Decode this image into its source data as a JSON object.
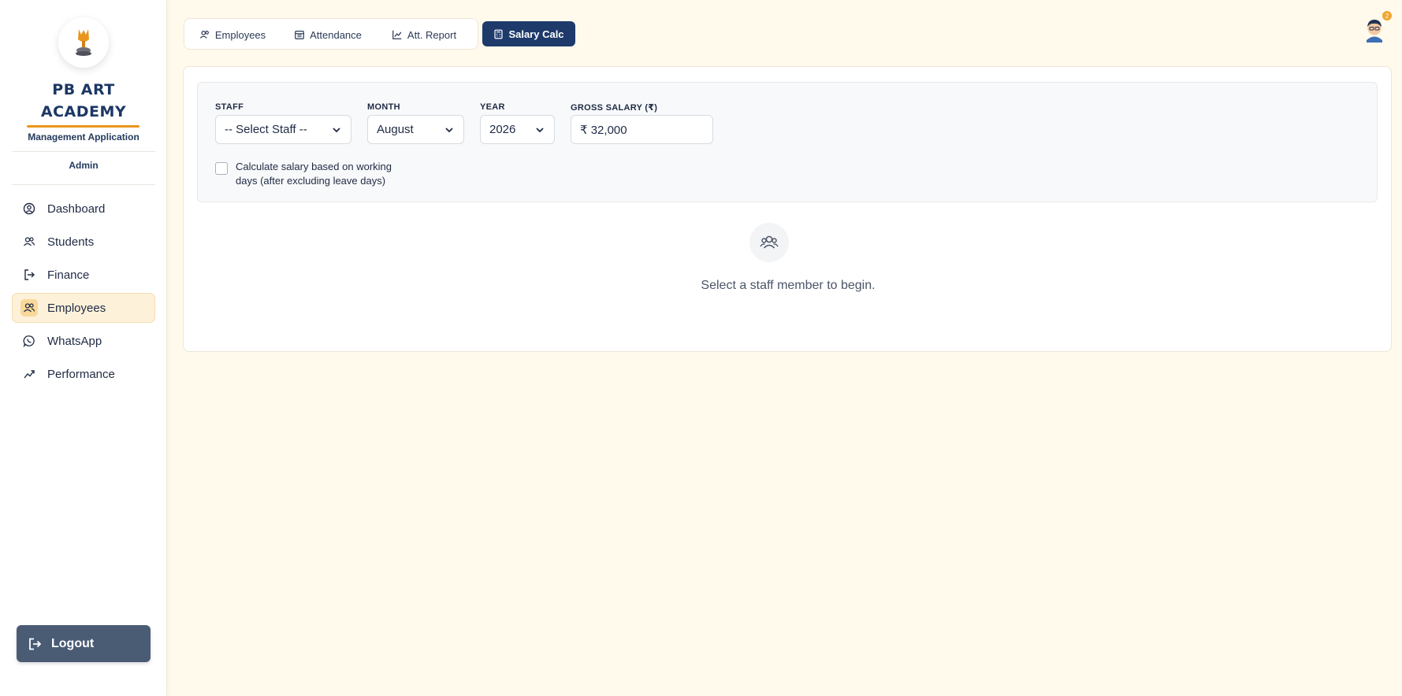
{
  "sidebar": {
    "brand_line1": "PB ART",
    "brand_line2": "ACADEMY",
    "subtitle": "Management Application",
    "role": "Admin",
    "items": [
      {
        "label": "Dashboard",
        "icon": "dashboard-icon"
      },
      {
        "label": "Students",
        "icon": "students-icon"
      },
      {
        "label": "Finance",
        "icon": "finance-icon"
      },
      {
        "label": "Employees",
        "icon": "employees-icon",
        "active": true
      },
      {
        "label": "WhatsApp",
        "icon": "whatsapp-icon"
      },
      {
        "label": "Performance",
        "icon": "performance-icon"
      }
    ],
    "logout_label": "Logout"
  },
  "tabs": [
    {
      "label": "Employees",
      "icon": "employees-icon"
    },
    {
      "label": "Attendance",
      "icon": "calendar-icon"
    },
    {
      "label": "Att. Report",
      "icon": "chart-icon"
    },
    {
      "label": "Salary Calc",
      "icon": "calculator-icon",
      "active": true
    }
  ],
  "header": {
    "notification_count": "2"
  },
  "form": {
    "staff_label": "STAFF",
    "staff_value": "-- Select Staff --",
    "month_label": "MONTH",
    "month_value": "August",
    "year_label": "YEAR",
    "year_value": "2026",
    "gross_label": "GROSS SALARY (₹)",
    "gross_value": "₹ 32,000",
    "checkbox_label": "Calculate salary based on working days (after excluding leave days)",
    "checkbox_checked": false
  },
  "empty_state": {
    "message": "Select a staff member to begin."
  },
  "colors": {
    "accent": "#1e3a6b",
    "underline": "#e8961e",
    "background": "#fffaeb",
    "active_nav": "#fdf1d9"
  }
}
